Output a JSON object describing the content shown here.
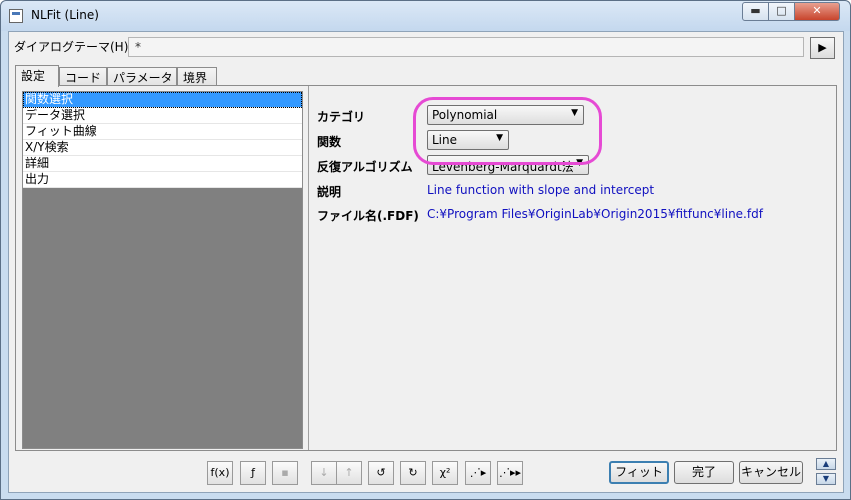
{
  "window": {
    "title": "NLFit (Line)",
    "minimize_label": "▬",
    "maximize_label": "□",
    "close_label": "✕"
  },
  "theme": {
    "label": "ダイアログテーマ(H)",
    "value": "*",
    "arrow": "▶"
  },
  "tabs": [
    {
      "label": "設定",
      "active": true
    },
    {
      "label": "コード"
    },
    {
      "label": "パラメータ"
    },
    {
      "label": "境界"
    }
  ],
  "tree": {
    "items": [
      {
        "label": "関数選択",
        "selected": true
      },
      {
        "label": "データ選択"
      },
      {
        "label": "フィット曲線"
      },
      {
        "label": "X/Y検索"
      },
      {
        "label": "詳細"
      },
      {
        "label": "出力"
      }
    ]
  },
  "settings": {
    "category_label": "カテゴリ",
    "category_value": "Polynomial",
    "function_label": "関数",
    "function_value": "Line",
    "algorithm_label": "反復アルゴリズム",
    "algorithm_value": "Levenberg-Marquardt法",
    "description_label": "説明",
    "description_value": "Line function with slope and intercept",
    "file_label": "ファイル名(.FDF)",
    "file_value": "C:¥Program Files¥OriginLab¥Origin2015¥fitfunc¥line.fdf"
  },
  "toolbar": {
    "icons": [
      {
        "name": "function-icon",
        "glyph": "f(x)",
        "enabled": true
      },
      {
        "name": "function-builder-icon",
        "glyph": "ƒ",
        "enabled": true
      },
      {
        "name": "save-icon",
        "glyph": "▪",
        "enabled": false
      },
      {
        "name": "sort-down-icon",
        "glyph": "↓",
        "enabled": false
      },
      {
        "name": "sort-up-icon",
        "glyph": "↑",
        "enabled": false
      },
      {
        "name": "reset-icon",
        "glyph": "↺",
        "enabled": true
      },
      {
        "name": "reset-all-icon",
        "glyph": "↻",
        "enabled": true
      },
      {
        "name": "chi-square-icon",
        "glyph": "χ²",
        "enabled": true
      },
      {
        "name": "one-iteration-icon",
        "glyph": "⋰▸",
        "enabled": true
      },
      {
        "name": "fit-until-converged-icon",
        "glyph": "⋰▸▸",
        "enabled": true
      }
    ],
    "fit_label": "フィット",
    "done_label": "完了",
    "cancel_label": "キャンセル",
    "scroll_up": "▲",
    "scroll_down": "▼"
  },
  "colors": {
    "selection": "#3399ff",
    "highlight_ring": "#e64ad4",
    "info_text": "#1010c0"
  }
}
